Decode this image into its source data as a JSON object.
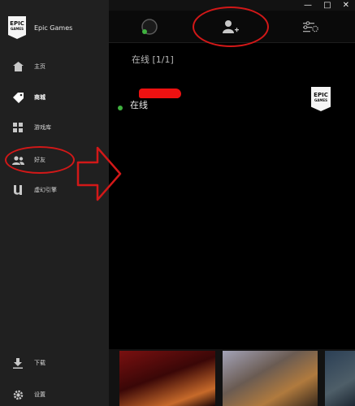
{
  "brand": {
    "name": "Epic Games",
    "logo_line1": "EPIC",
    "logo_line2": "GAMES"
  },
  "sidebar": {
    "items": [
      {
        "label": "主页",
        "icon": "home-icon"
      },
      {
        "label": "商城",
        "icon": "tag-icon",
        "active": true
      },
      {
        "label": "游戏库",
        "icon": "grid-icon"
      },
      {
        "label": "好友",
        "icon": "friends-icon"
      },
      {
        "label": "虚幻引擎",
        "icon": "unreal-icon"
      }
    ],
    "bottom_items": [
      {
        "label": "下载",
        "icon": "download-icon"
      },
      {
        "label": "设置",
        "icon": "gear-icon"
      }
    ]
  },
  "window_controls": {
    "minimize": "—",
    "maximize": "□",
    "close": "✕"
  },
  "friends_panel": {
    "tabs": [
      "status-tab",
      "add-friend-tab",
      "settings-tab"
    ],
    "online_header": "在线 [1/1]",
    "friend": {
      "status": "在线",
      "game_logo_line1": "EPIC",
      "game_logo_line2": "GAMES"
    }
  },
  "colors": {
    "accent_red": "#d21818",
    "online_green": "#3fb13f",
    "sidebar_bg": "#202020"
  }
}
